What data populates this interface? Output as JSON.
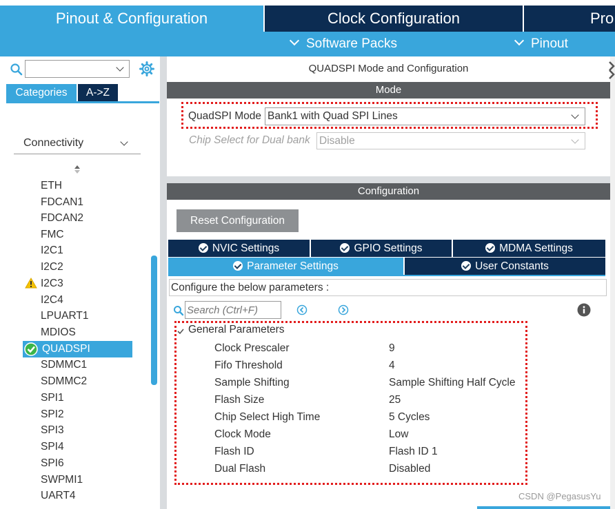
{
  "top_tabs": [
    {
      "label": "Pinout & Configuration",
      "active": true
    },
    {
      "label": "Clock Configuration",
      "active": false
    },
    {
      "label": "Pro",
      "active": false
    }
  ],
  "sub_bar": {
    "software_packs": "Software Packs",
    "pinout": "Pinout"
  },
  "left": {
    "search_value": "",
    "tabs": {
      "categories": "Categories",
      "az": "A->Z"
    },
    "category": "Connectivity",
    "items": [
      {
        "label": "ETH"
      },
      {
        "label": "FDCAN1"
      },
      {
        "label": "FDCAN2"
      },
      {
        "label": "FMC"
      },
      {
        "label": "I2C1"
      },
      {
        "label": "I2C2"
      },
      {
        "label": "I2C3",
        "status": "warning"
      },
      {
        "label": "I2C4"
      },
      {
        "label": "LPUART1"
      },
      {
        "label": "MDIOS"
      },
      {
        "label": "QUADSPI",
        "status": "ok",
        "selected": true
      },
      {
        "label": "SDMMC1"
      },
      {
        "label": "SDMMC2"
      },
      {
        "label": "SPI1"
      },
      {
        "label": "SPI2"
      },
      {
        "label": "SPI3"
      },
      {
        "label": "SPI4"
      },
      {
        "label": "SPI6"
      },
      {
        "label": "SWPMI1"
      },
      {
        "label": "UART4"
      }
    ]
  },
  "right": {
    "title": "QUADSPI Mode and Configuration",
    "mode_bar": "Mode",
    "quadspi_mode_label": "QuadSPI Mode",
    "quadspi_mode_value": "Bank1 with Quad SPI Lines",
    "chip_select_label": "Chip Select for Dual bank",
    "chip_select_value": "Disable",
    "config_bar": "Configuration",
    "reset_button": "Reset Configuration",
    "tabs_row1": [
      "NVIC Settings",
      "GPIO Settings",
      "MDMA Settings"
    ],
    "tabs_row2": [
      "Parameter Settings",
      "User Constants"
    ],
    "configure_text": "Configure the below parameters :",
    "search_placeholder": "Search (Ctrl+F)",
    "group_title": "General Parameters",
    "params": [
      {
        "name": "Clock Prescaler",
        "value": "9"
      },
      {
        "name": "Fifo Threshold",
        "value": "4"
      },
      {
        "name": "Sample Shifting",
        "value": "Sample Shifting Half Cycle"
      },
      {
        "name": "Flash Size",
        "value": "25"
      },
      {
        "name": "Chip Select High Time",
        "value": "5 Cycles"
      },
      {
        "name": "Clock Mode",
        "value": "Low"
      },
      {
        "name": "Flash ID",
        "value": "Flash ID 1"
      },
      {
        "name": "Dual Flash",
        "value": "Disabled"
      }
    ]
  },
  "watermark": "CSDN @PegasusYu",
  "colors": {
    "accent": "#39a6dc",
    "dark_navy": "#0c2c52",
    "section_bar": "#5a5d60",
    "highlight_border": "#e21c1c",
    "warning": "#f5c200",
    "ok": "#3bb54a"
  }
}
